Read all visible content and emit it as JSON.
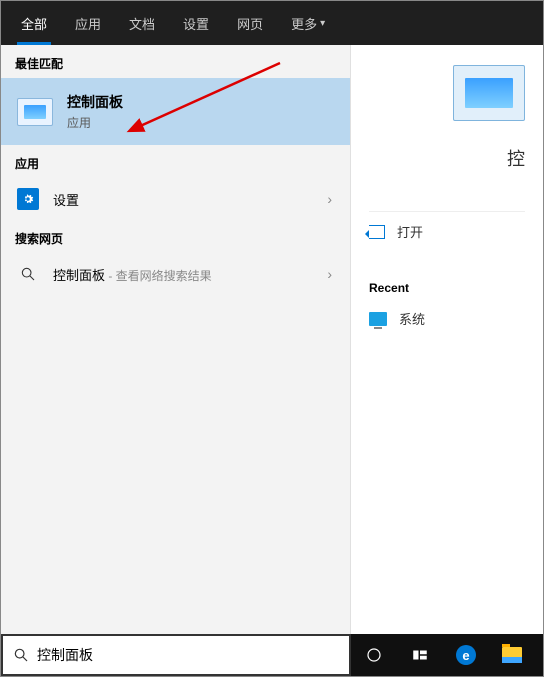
{
  "tabs": {
    "all": "全部",
    "apps": "应用",
    "docs": "文档",
    "settings": "设置",
    "web": "网页",
    "more": "更多"
  },
  "sections": {
    "best_match": "最佳匹配",
    "apps": "应用",
    "search_web": "搜索网页"
  },
  "hero": {
    "title": "控制面板",
    "subtitle": "应用"
  },
  "app_item": {
    "label": "设置"
  },
  "web_item": {
    "prefix": "控制面板",
    "suffix": " - 查看网络搜索结果"
  },
  "preview": {
    "title_fragment": "控",
    "open": "打开",
    "recent_header": "Recent",
    "recent_item": "系统"
  },
  "search": {
    "value": "控制面板",
    "placeholder": ""
  }
}
